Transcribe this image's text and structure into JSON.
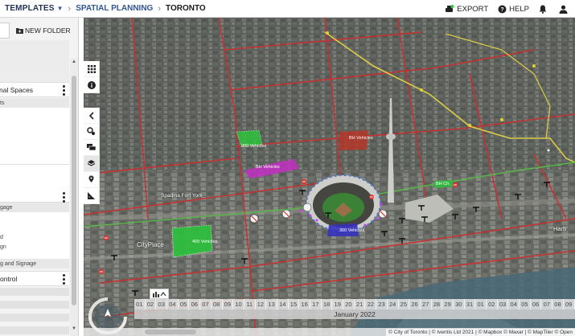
{
  "breadcrumb": {
    "templates": "TEMPLATES",
    "planning": "SPATIAL PLANNING",
    "city": "TORONTO",
    "separator": "›"
  },
  "topbar": {
    "export_label": "EXPORT",
    "help_label": "HELP"
  },
  "sidebar": {
    "new_folder_label": "NEW FOLDER",
    "sections": [
      {
        "label": "nal Spaces"
      },
      {
        "label": ""
      },
      {
        "label": "ontrol"
      }
    ],
    "rows": {
      "sub1": "ts",
      "sub2": "gage",
      "plain1": "d",
      "plain2": "gn",
      "sub3": "g and Signage"
    }
  },
  "map": {
    "place_labels": {
      "spadina": "Spadina Fort York",
      "cityplace": "CityPlace",
      "harbour": "Harb"
    },
    "zone_labels": {
      "zone_red": "BH Vehicles",
      "zone_green_a": "200 Vehicles",
      "zone_green_b": "400 Vehicles",
      "zone_blue": "300 Vehicles",
      "zone_magenta": "BH Vehicles",
      "zone_green_small": "BH Ch"
    }
  },
  "timeline": {
    "days": [
      "01",
      "02",
      "03",
      "04",
      "05",
      "06",
      "07",
      "08",
      "09",
      "10",
      "11",
      "12",
      "13",
      "14",
      "15",
      "16",
      "17",
      "18",
      "19",
      "20",
      "21",
      "22",
      "23",
      "24",
      "25",
      "26",
      "27",
      "28",
      "29",
      "30",
      "31",
      "01",
      "02",
      "03",
      "04",
      "05",
      "06",
      "07",
      "08",
      "09"
    ],
    "month": "January 2022"
  },
  "attribution": "© City of Toronto | © Iventis Ltd 2021 | © Mapbox © Maxar | © MapTiler © Open",
  "colors": {
    "accent": "#2f5597",
    "route_red": "#d93030",
    "route_yellow": "#e8d84a",
    "route_green": "#5bc24a",
    "zone_green": "#2ecc40",
    "zone_red": "#c0392b",
    "zone_magenta": "#cc33cc",
    "zone_blue": "#3a35c8"
  }
}
